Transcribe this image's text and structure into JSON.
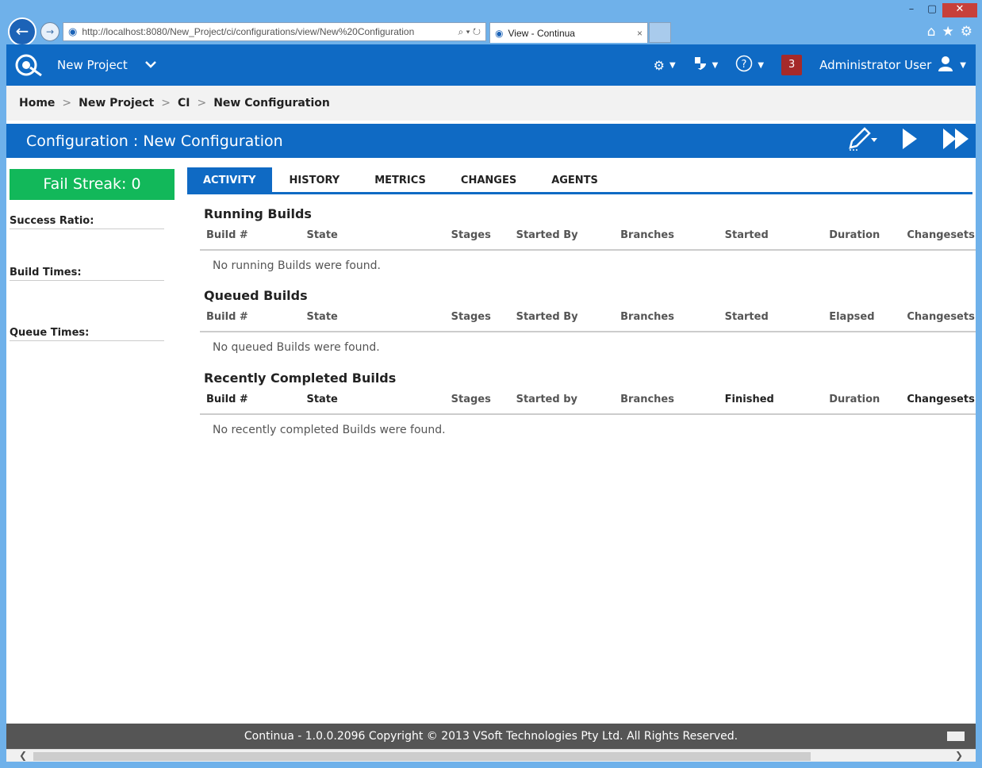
{
  "browser": {
    "url": "http://localhost:8080/New_Project/ci/configurations/view/New%20Configuration",
    "tab_title": "View - Continua",
    "tab_close": "×"
  },
  "topnav": {
    "project_name": "New Project",
    "notification_count": "3",
    "user_name": "Administrator User"
  },
  "breadcrumb": {
    "items": [
      "Home",
      "New Project",
      "CI",
      "New Configuration"
    ],
    "separator": ">"
  },
  "title": "Configuration : New Configuration",
  "left_panel": {
    "fail_streak": "Fail Streak: 0",
    "success_ratio_label": "Success Ratio:",
    "build_times_label": "Build Times:",
    "queue_times_label": "Queue Times:"
  },
  "tabs": [
    "ACTIVITY",
    "HISTORY",
    "METRICS",
    "CHANGES",
    "AGENTS"
  ],
  "sections": {
    "running": {
      "title": "Running Builds",
      "columns": [
        "Build #",
        "State",
        "Stages",
        "Started By",
        "Branches",
        "Started",
        "Duration",
        "Changesets"
      ],
      "empty": "No running Builds were found."
    },
    "queued": {
      "title": "Queued Builds",
      "columns": [
        "Build #",
        "State",
        "Stages",
        "Started By",
        "Branches",
        "Started",
        "Elapsed",
        "Changesets"
      ],
      "empty": "No queued Builds were found."
    },
    "completed": {
      "title": "Recently Completed Builds",
      "columns": [
        "Build #",
        "State",
        "Stages",
        "Started by",
        "Branches",
        "Finished",
        "Duration",
        "Changesets"
      ],
      "empty": "No recently completed Builds were found."
    }
  },
  "footer": "Continua - 1.0.0.2096 Copyright © 2013 VSoft Technologies Pty Ltd. All Rights Reserved.",
  "colors": {
    "brand_blue": "#0f6ac4",
    "streak_green": "#12b85a",
    "notification_red": "#a52a2a"
  }
}
